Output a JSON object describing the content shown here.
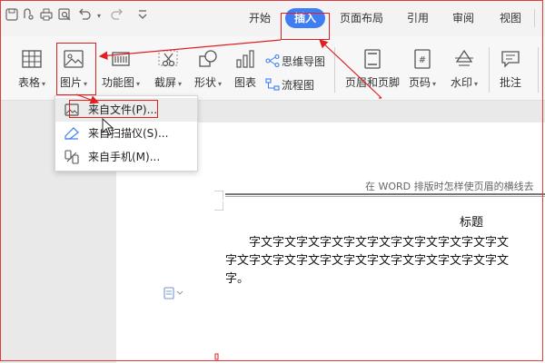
{
  "quick_access": {
    "icons": [
      "save-icon",
      "undo-history-icon",
      "print-icon",
      "preview-icon",
      "undo-icon",
      "redo-icon",
      "customize-icon"
    ]
  },
  "menu_tabs": [
    {
      "label": "开始"
    },
    {
      "label": "插入",
      "active": true
    },
    {
      "label": "页面布局"
    },
    {
      "label": "引用"
    },
    {
      "label": "审阅"
    },
    {
      "label": "视图"
    }
  ],
  "ribbon": {
    "table": {
      "label": "表格"
    },
    "picture": {
      "label": "图片"
    },
    "feature_chart": {
      "label": "功能图"
    },
    "screenshot": {
      "label": "截屏"
    },
    "shape": {
      "label": "形状"
    },
    "chart": {
      "label": "图表"
    },
    "mindmap": {
      "label": "思维导图"
    },
    "flowchart": {
      "label": "流程图"
    },
    "header_footer": {
      "label": "页眉和页脚"
    },
    "page_number": {
      "label": "页码"
    },
    "watermark": {
      "label": "水印"
    },
    "comment": {
      "label": "批注"
    }
  },
  "dropdown": {
    "items": [
      {
        "label": "来自文件(P)...",
        "icon": "image-file-icon"
      },
      {
        "label": "来自扫描仪(S)...",
        "icon": "scanner-icon"
      },
      {
        "label": "来自手机(M)...",
        "icon": "phone-transfer-icon"
      }
    ]
  },
  "document": {
    "header_text": "在 WORD 排版时怎样使页眉的横线去",
    "title": "标题",
    "lines": [
      "字文字文字文字文字文字文字文字文字文字文字文",
      "字文字文字文字文字文字文字文字文字文字文字文字文",
      "字。"
    ]
  },
  "colors": {
    "accent": "#3f7df3",
    "annotation": "#e02020",
    "ribbon_bg": "#f7f7f7",
    "workspace_bg": "#e9e9e9"
  }
}
